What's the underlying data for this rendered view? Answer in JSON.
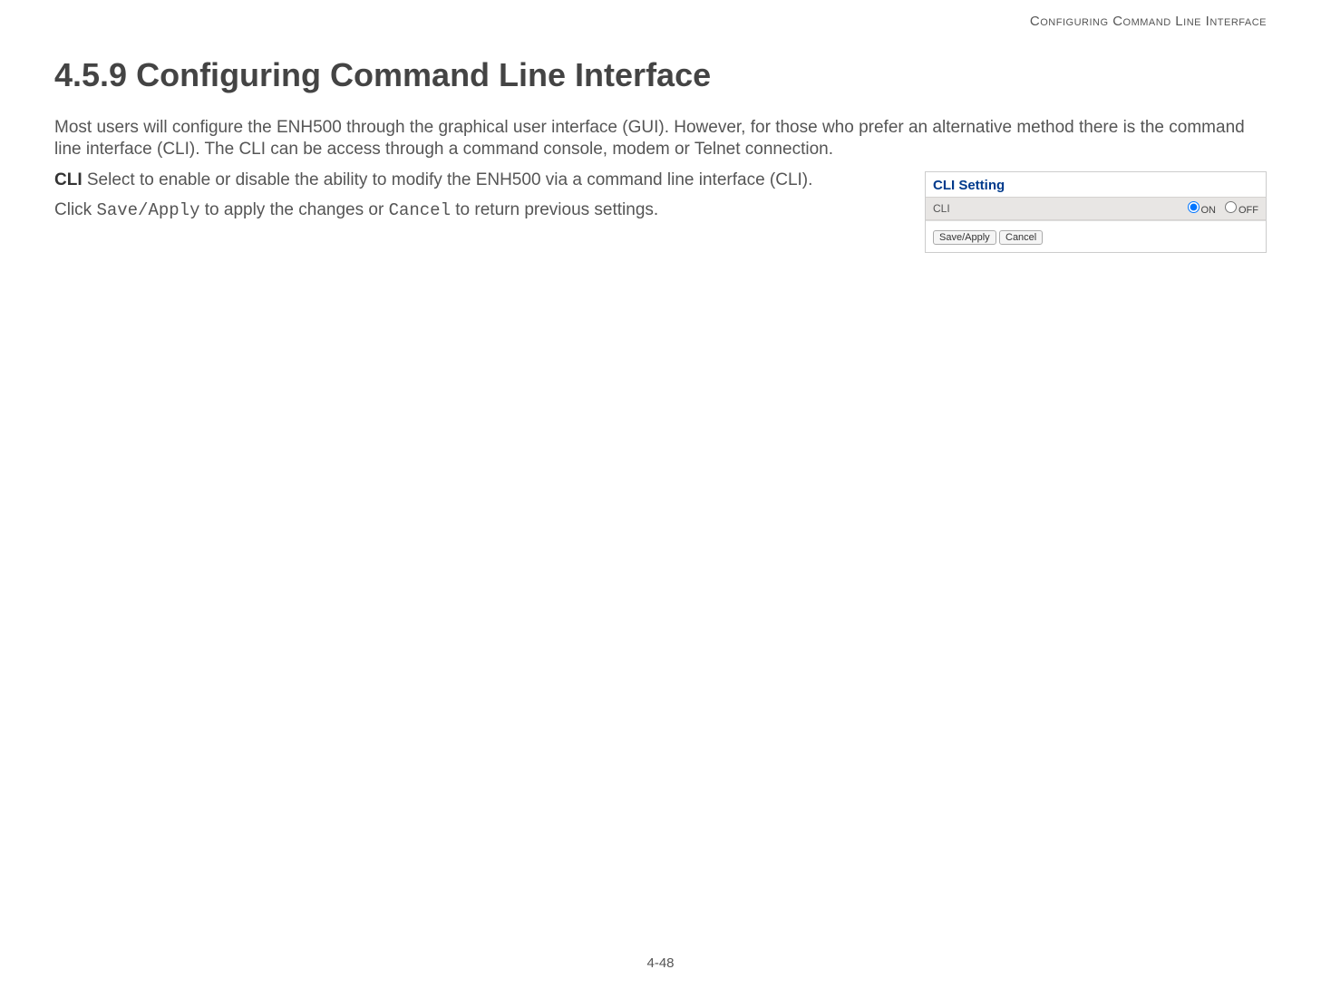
{
  "header": {
    "running_head": "Configuring Command Line Interface"
  },
  "section": {
    "number": "4.5.9",
    "title": "Configuring Command Line Interface"
  },
  "body": {
    "intro": "Most users will configure the ENH500 through the graphical user interface (GUI). However, for those who prefer an alternative method there is the command line interface (CLI).  The CLI can be access through a command console, modem or Telnet connection.",
    "cli_label": "CLI",
    "cli_desc": "  Select to enable or disable the ability to modify the ENH500 via a command line interface (CLI).",
    "click_prefix": "Click ",
    "save_apply_code": "Save/Apply",
    "mid_text": " to apply the changes or ",
    "cancel_code": "Cancel",
    "end_text": "  to return previous settings."
  },
  "figure": {
    "panel_title": "CLI Setting",
    "row_label": "CLI",
    "radio_on": "ON",
    "radio_off": "OFF",
    "btn_save": "Save/Apply",
    "btn_cancel": "Cancel"
  },
  "footer": {
    "page_number": "4-48"
  }
}
